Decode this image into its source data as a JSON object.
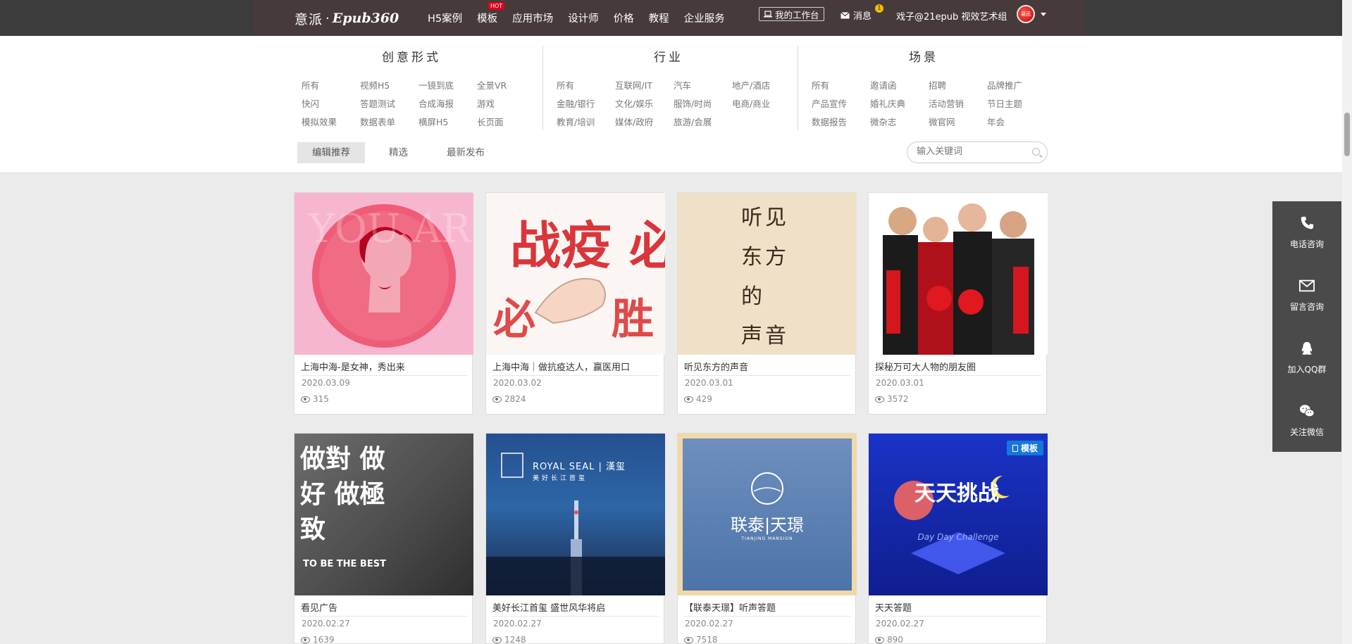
{
  "header": {
    "logo_cn": "意派",
    "logo_dot": "·",
    "logo_en": "Epub360",
    "nav": [
      {
        "label": "H5案例"
      },
      {
        "label": "模板",
        "badge": "HOT"
      },
      {
        "label": "应用市场"
      },
      {
        "label": "设计师"
      },
      {
        "label": "价格"
      },
      {
        "label": "教程"
      },
      {
        "label": "企业服务"
      }
    ],
    "workbench_label": "我的工作台",
    "message_label": "消息",
    "message_badge": "1",
    "username": "戏子@21epub 视效艺术组",
    "avatar_text": "易迅"
  },
  "filters": {
    "groups": [
      {
        "title": "创意形式",
        "items": [
          "所有",
          "视频H5",
          "一镜到底",
          "全景VR",
          "快闪",
          "答题测试",
          "合成海报",
          "游戏",
          "模拟效果",
          "数据表单",
          "横屏H5",
          "长页面"
        ]
      },
      {
        "title": "行业",
        "items": [
          "所有",
          "互联网/IT",
          "汽车",
          "地产/酒店",
          "金融/银行",
          "文化/娱乐",
          "服饰/时尚",
          "电商/商业",
          "教育/培训",
          "媒体/政府",
          "旅游/会展"
        ]
      },
      {
        "title": "场景",
        "items": [
          "所有",
          "邀请函",
          "招聘",
          "品牌推广",
          "产品宣传",
          "婚礼庆典",
          "活动营销",
          "节日主题",
          "数据报告",
          "微杂志",
          "微官网",
          "年会"
        ]
      }
    ],
    "tabs": [
      {
        "label": "编辑推荐",
        "active": true
      },
      {
        "label": "精选"
      },
      {
        "label": "最新发布"
      }
    ],
    "search_placeholder": "输入关键词"
  },
  "cards": [
    {
      "title": "上海中海-是女神，秀出来",
      "date": "2020.03.09",
      "views": "315",
      "thumb_text": "YOU ARE AWESOME"
    },
    {
      "title": "上海中海｜做抗疫达人，赢医用口",
      "date": "2020.03.02",
      "views": "2824",
      "thumb_text": "战疫 必胜"
    },
    {
      "title": "听见东方的声音",
      "date": "2020.03.01",
      "views": "429",
      "thumb_text": "听见 东方 的 声音"
    },
    {
      "title": "探秘万可大人物的朋友圈",
      "date": "2020.03.01",
      "views": "3572",
      "thumb_text": ""
    },
    {
      "title": "看见广告",
      "date": "2020.02.27",
      "views": "1639",
      "thumb_text": "做對 做好 做極致",
      "thumb_sub": "TO BE THE BEST"
    },
    {
      "title": "美好长江首玺 盛世风华将启",
      "date": "2020.02.27",
      "views": "1248",
      "thumb_text": "ROYAL SEAL | 漢玺",
      "thumb_sub": "美好长江首玺"
    },
    {
      "title": "【联泰天璟】听声答题",
      "date": "2020.02.27",
      "views": "7518",
      "thumb_text": "联泰|天璟",
      "thumb_sub": "TIANJING MANSION"
    },
    {
      "title": "天天答题",
      "date": "2020.02.27",
      "views": "890",
      "thumb_text": "天天挑战",
      "thumb_sub": "Day Day Challenge",
      "tag": "模板"
    }
  ],
  "floatbar": [
    {
      "label": "电话咨询",
      "icon": "phone-icon"
    },
    {
      "label": "留言咨询",
      "icon": "envelope-icon"
    },
    {
      "label": "加入QQ群",
      "icon": "qq-icon"
    },
    {
      "label": "关注微信",
      "icon": "wechat-icon"
    }
  ]
}
